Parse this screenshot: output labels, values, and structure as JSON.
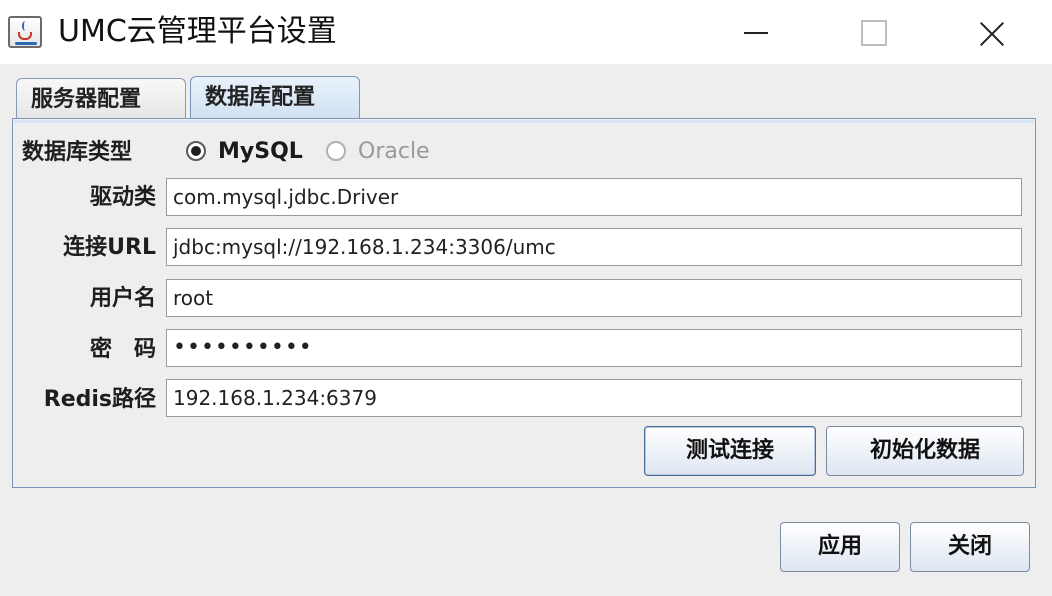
{
  "window": {
    "title": "UMC云管理平台设置"
  },
  "tabs": [
    {
      "label": "服务器配置",
      "active": false
    },
    {
      "label": "数据库配置",
      "active": true
    }
  ],
  "form": {
    "db_type_label": "数据库类型",
    "db_type_options": [
      {
        "label": "MySQL",
        "selected": true,
        "enabled": true
      },
      {
        "label": "Oracle",
        "selected": false,
        "enabled": false
      }
    ],
    "driver_label": "驱动类",
    "driver_value": "com.mysql.jdbc.Driver",
    "url_label": "连接URL",
    "url_value": "jdbc:mysql://192.168.1.234:3306/umc",
    "username_label": "用户名",
    "username_value": "root",
    "password_label": "密　码",
    "password_value": "••••••••••",
    "redis_label": "Redis路径",
    "redis_value": "192.168.1.234:6379"
  },
  "panel_buttons": {
    "test_label": "测试连接",
    "init_label": "初始化数据"
  },
  "dialog_buttons": {
    "apply_label": "应用",
    "close_label": "关闭"
  },
  "colors": {
    "tab_active": "#cfe0f2",
    "panel_border": "#7b96b8",
    "background": "#eeeeee"
  }
}
